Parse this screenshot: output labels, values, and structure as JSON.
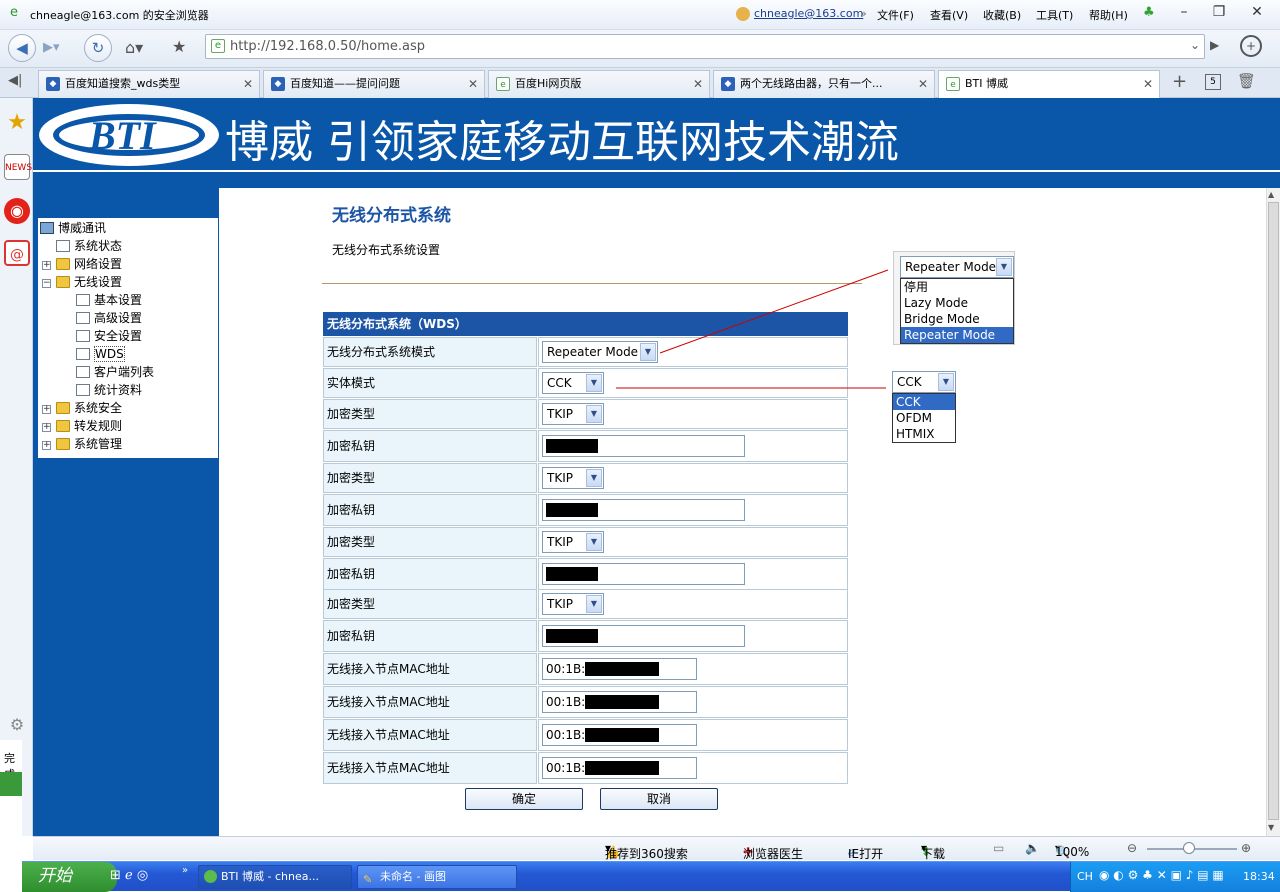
{
  "titlebar": {
    "title": "chneagle@163.com 的安全浏览器",
    "user": "chneagle@163.com",
    "menus": [
      "文件(F)",
      "查看(V)",
      "收藏(B)",
      "工具(T)",
      "帮助(H)"
    ]
  },
  "navbar": {
    "url": "http://192.168.0.50/home.asp"
  },
  "tabs": [
    {
      "label": "百度知道搜索_wds类型"
    },
    {
      "label": "百度知道——提问问题"
    },
    {
      "label": "百度Hi网页版"
    },
    {
      "label": "两个无线路由器，只有一个..."
    },
    {
      "label": "BTI 博威"
    }
  ],
  "tab_count": "5",
  "banner": {
    "logo": "BTI",
    "slogan": "博威 引领家庭移动互联网技术潮流"
  },
  "tree": {
    "root": "博威通讯",
    "items": [
      "系统状态",
      "网络设置",
      "无线设置",
      "基本设置",
      "高级设置",
      "安全设置",
      "WDS",
      "客户端列表",
      "统计资料",
      "系统安全",
      "转发规则",
      "系统管理"
    ]
  },
  "page": {
    "title": "无线分布式系统",
    "subtitle": "无线分布式系统设置",
    "table_header": "无线分布式系统（WDS）",
    "rows": [
      {
        "label": "无线分布式系统模式",
        "type": "select",
        "value": "Repeater Mode"
      },
      {
        "label": "实体模式",
        "type": "select",
        "value": "CCK"
      },
      {
        "label": "加密类型",
        "type": "select",
        "value": "TKIP"
      },
      {
        "label": "加密私钥",
        "type": "text",
        "value": ""
      },
      {
        "label": "加密类型",
        "type": "select",
        "value": "TKIP"
      },
      {
        "label": "加密私钥",
        "type": "text",
        "value": ""
      },
      {
        "label": "加密类型",
        "type": "select",
        "value": "TKIP"
      },
      {
        "label": "加密私钥",
        "type": "text",
        "value": ""
      },
      {
        "label": "加密类型",
        "type": "select",
        "value": "TKIP"
      },
      {
        "label": "加密私钥",
        "type": "text",
        "value": ""
      },
      {
        "label": "无线接入节点MAC地址",
        "type": "text",
        "value": "00:1B:"
      },
      {
        "label": "无线接入节点MAC地址",
        "type": "text",
        "value": "00:1B:"
      },
      {
        "label": "无线接入节点MAC地址",
        "type": "text",
        "value": "00:1B:"
      },
      {
        "label": "无线接入节点MAC地址",
        "type": "text",
        "value": "00:1B:"
      }
    ],
    "ok": "确定",
    "cancel": "取消"
  },
  "callouts": {
    "mode": {
      "selected": "Repeater Mode",
      "options": [
        "停用",
        "Lazy Mode",
        "Bridge Mode",
        "Repeater Mode"
      ]
    },
    "phy": {
      "selected": "CCK",
      "options": [
        "CCK",
        "OFDM",
        "HTMIX"
      ]
    }
  },
  "status": {
    "left": "完成",
    "items": [
      "推荐到360搜索",
      "浏览器医生",
      "IE打开",
      "下载"
    ],
    "zoom": "100%"
  },
  "taskbar": {
    "start": "开始",
    "tasks": [
      "BTI 博威 - chnea...",
      "未命名 - 画图"
    ],
    "lang": "CH",
    "time": "18:34"
  }
}
